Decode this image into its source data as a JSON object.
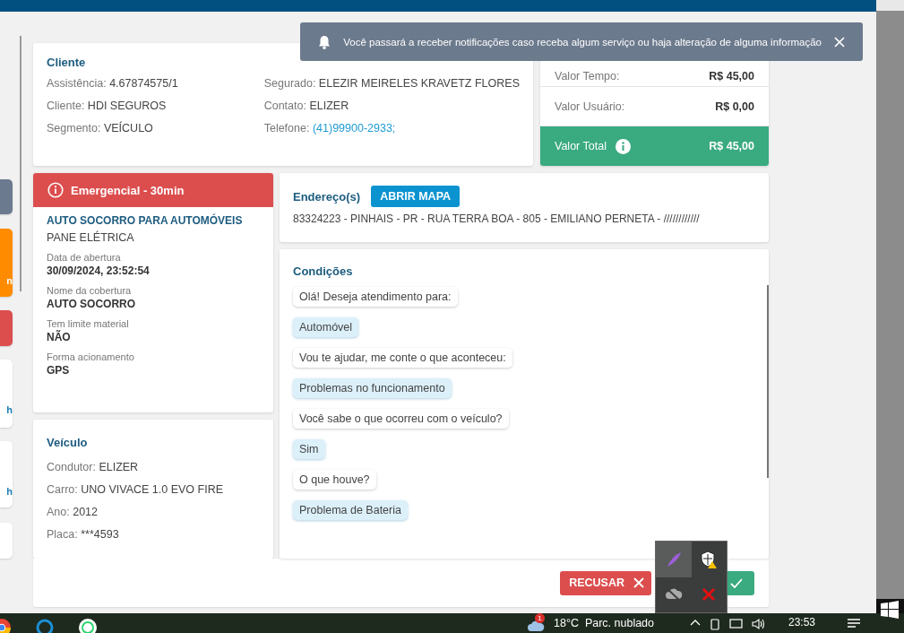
{
  "notification": {
    "text": "Você passará a receber notificações caso receba algum serviço ou haja alteração de alguma informação"
  },
  "sidebar_cards": [
    {
      "color": "#6b7a8f"
    },
    {
      "color": "#ff8c00",
      "text": "n"
    },
    {
      "color": "#dc4e4e"
    },
    {
      "color": "#ffffff",
      "text": "h"
    },
    {
      "color": "#ffffff",
      "text": "h"
    },
    {
      "color": "#ffffff"
    }
  ],
  "client": {
    "title": "Cliente",
    "fields_left": [
      {
        "label": "Assistência:",
        "value": "4.67874575/1",
        "link": false
      },
      {
        "label": "Cliente:",
        "value": "HDI SEGUROS",
        "link": false
      },
      {
        "label": "Segmento:",
        "value": "VEÍCULO",
        "link": false
      }
    ],
    "fields_right": [
      {
        "label": "Segurado:",
        "value": "ELEZIR MEIRELES KRAVETZ FLORES",
        "link": false
      },
      {
        "label": "Contato:",
        "value": "ELIZER",
        "link": false
      },
      {
        "label": "Telefone:",
        "value": "(41)99900-2933;",
        "link": true
      }
    ]
  },
  "pricing": {
    "rows": [
      {
        "label": "Valor Tempo:",
        "value": "R$ 45,00",
        "kind": "plain"
      },
      {
        "label": "Valor Usuário:",
        "value": "R$ 0,00",
        "kind": "plain"
      },
      {
        "label": "Valor Total",
        "value": "R$ 45,00",
        "kind": "total"
      }
    ]
  },
  "service": {
    "badge": "Emergencial - 30min",
    "title": "AUTO SOCORRO PARA AUTOMÓVEIS",
    "subtitle": "PANE ELÉTRICA",
    "details": [
      {
        "label": "Data de abertura",
        "value": "30/09/2024, 23:52:54"
      },
      {
        "label": "Nome da cobertura",
        "value": "AUTO SOCORRO"
      },
      {
        "label": "Tem limite material",
        "value": "NÃO"
      },
      {
        "label": "Forma acionamento",
        "value": "GPS"
      }
    ]
  },
  "vehicle": {
    "title": "Veículo",
    "fields": [
      {
        "label": "Condutor:",
        "value": "ELIZER"
      },
      {
        "label": "Carro:",
        "value": "UNO VIVACE 1.0 EVO FIRE"
      },
      {
        "label": "Ano:",
        "value": "2012"
      },
      {
        "label": "Placa:",
        "value": "***4593"
      }
    ]
  },
  "address": {
    "title": "Endereço(s)",
    "button": "ABRIR MAPA",
    "text": "83324223 - PINHAIS - PR - RUA TERRA BOA - 805 - EMILIANO PERNETA - ////////////"
  },
  "conditions": {
    "title": "Condições",
    "messages": [
      {
        "text": "Olá! Deseja atendimento para:",
        "kind": "question"
      },
      {
        "text": "Automóvel",
        "kind": "answer"
      },
      {
        "text": "Vou te ajudar, me conte o que aconteceu:",
        "kind": "question"
      },
      {
        "text": "Problemas no funcionamento",
        "kind": "answer"
      },
      {
        "text": "Você sabe o que ocorreu com o veículo?",
        "kind": "question"
      },
      {
        "text": "Sim",
        "kind": "answer"
      },
      {
        "text": "O que houve?",
        "kind": "question"
      },
      {
        "text": "Problema de Bateria",
        "kind": "answer"
      }
    ]
  },
  "actions": {
    "reject": "RECUSAR"
  },
  "taskbar": {
    "weather_badge": "1",
    "weather": "18°C  Parc. nublado",
    "time": "23:53"
  }
}
